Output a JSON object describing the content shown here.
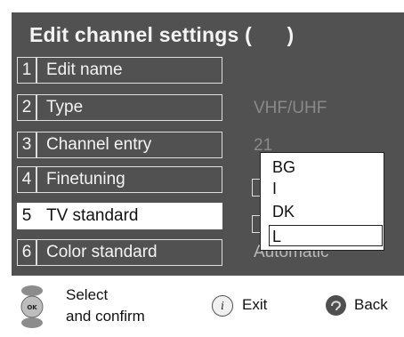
{
  "dialog": {
    "title": "Edit channel settings (      )",
    "items": [
      {
        "number": "1",
        "label": "Edit name",
        "value": ""
      },
      {
        "number": "2",
        "label": "Type",
        "value": "VHF/UHF"
      },
      {
        "number": "3",
        "label": "Channel entry",
        "value": "21"
      },
      {
        "number": "4",
        "label": "Finetuning",
        "value": ""
      },
      {
        "number": "5",
        "label": "TV standard",
        "value": ""
      },
      {
        "number": "6",
        "label": "Color standard",
        "value": "Automatic"
      }
    ],
    "selected_item": 5
  },
  "tv_standard_popup": {
    "options": [
      "BG",
      "I",
      "DK",
      "L"
    ],
    "highlighted_option": "L"
  },
  "footer": {
    "select_line1": "Select",
    "select_line2": "and confirm",
    "exit_label": "Exit",
    "back_label": "Back",
    "info_icon_glyph": "i",
    "ok_glyph": "OK"
  },
  "colors": {
    "screen_bg": "#515151",
    "text_light": "#f4f4f4",
    "value_grey": "#8a8a8a",
    "selected_bg": "#ffffff"
  },
  "icons": [
    "ok-navigation-cluster-icon",
    "info-button-icon",
    "back-button-icon"
  ]
}
